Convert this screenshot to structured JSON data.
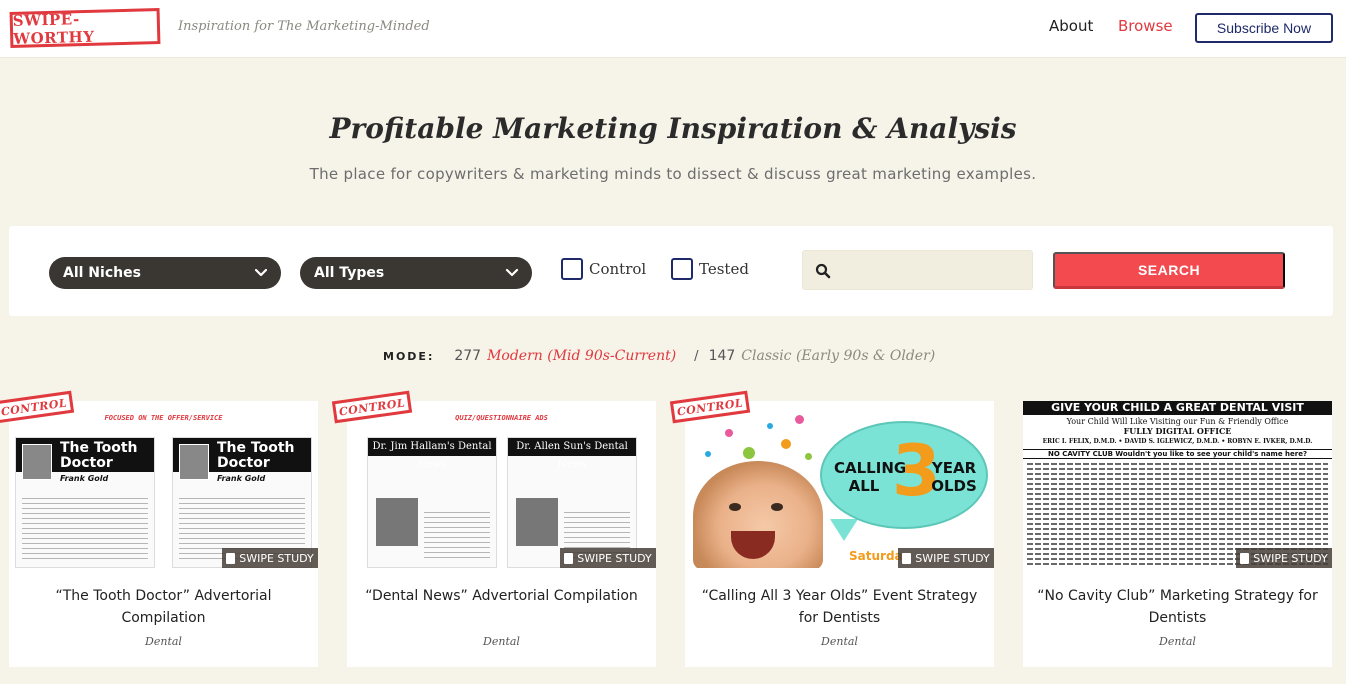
{
  "header": {
    "logo_text": "SWIPE-WORTHY",
    "tagline": "Inspiration for The Marketing-Minded",
    "nav": {
      "about": "About",
      "browse": "Browse"
    },
    "subscribe_label": "Subscribe Now"
  },
  "hero": {
    "title": "Profitable Marketing Inspiration & Analysis",
    "subtitle": "The place for copywriters & marketing minds to dissect & discuss great marketing examples."
  },
  "filters": {
    "niche_select": "All Niches",
    "type_select": "All Types",
    "control_label": "Control",
    "tested_label": "Tested",
    "search_value": "",
    "search_button": "SEARCH"
  },
  "mode": {
    "label": "MODE:",
    "modern_count": "277",
    "modern_label": "Modern (Mid 90s-Current)",
    "separator": "/",
    "classic_count": "147",
    "classic_label": "Classic (Early 90s & Older)"
  },
  "cards": [
    {
      "title": "“The Tooth Doctor” Advertorial Compilation",
      "niche": "Dental",
      "badge": "CONTROL",
      "ribbon": "SWIPE STUDY",
      "thumb": {
        "caption": "FOCUSED ON THE OFFER/SERVICE",
        "doc_left_title": "The Tooth Doctor",
        "doc_left_sub": "Frank Gold",
        "doc_right_title": "The Tooth Doctor",
        "doc_right_sub": "Frank Gold"
      }
    },
    {
      "title": "“Dental News” Advertorial Compilation",
      "niche": "Dental",
      "badge": "CONTROL",
      "ribbon": "SWIPE STUDY",
      "thumb": {
        "caption": "QUIZ/QUESTIONNAIRE ADS",
        "doc_left_title": "Dr. Jim Hallam's Dental News",
        "doc_right_title": "Dr. Allen Sun's Dental News"
      }
    },
    {
      "title": "“Calling All 3 Year Olds” Event Strategy for Dentists",
      "niche": "Dental",
      "badge": "CONTROL",
      "ribbon": "SWIPE STUDY",
      "thumb": {
        "line_left": "CALLING ALL",
        "number": "3",
        "line_right": "YEAR OLDS",
        "footer": "Saturday"
      }
    },
    {
      "title": "“No Cavity Club” Marketing Strategy for Dentists",
      "niche": "Dental",
      "ribbon": "SWIPE STUDY",
      "thumb": {
        "headline": "GIVE YOUR CHILD A GREAT DENTAL VISIT",
        "sub1": "Your Child Will Like Visiting our Fun & Friendly Office",
        "sub2": "FULLY DIGITAL OFFICE",
        "sub3": "ERIC I. FELIX, D.M.D. • DAVID S. IGLEWICZ, D.M.D. • ROBYN E. IVKER, D.M.D.",
        "bar": "NO CAVITY CLUB Wouldn't you like to see your child's name here?"
      }
    }
  ],
  "colors": {
    "accent_red": "#e0393e",
    "navy": "#1f2a6a",
    "background": "#f6f3e9",
    "select_dark": "#3a3732",
    "search_button": "#f24a4f"
  },
  "icons": [
    "chevron-down-icon",
    "search-icon",
    "document-icon"
  ]
}
